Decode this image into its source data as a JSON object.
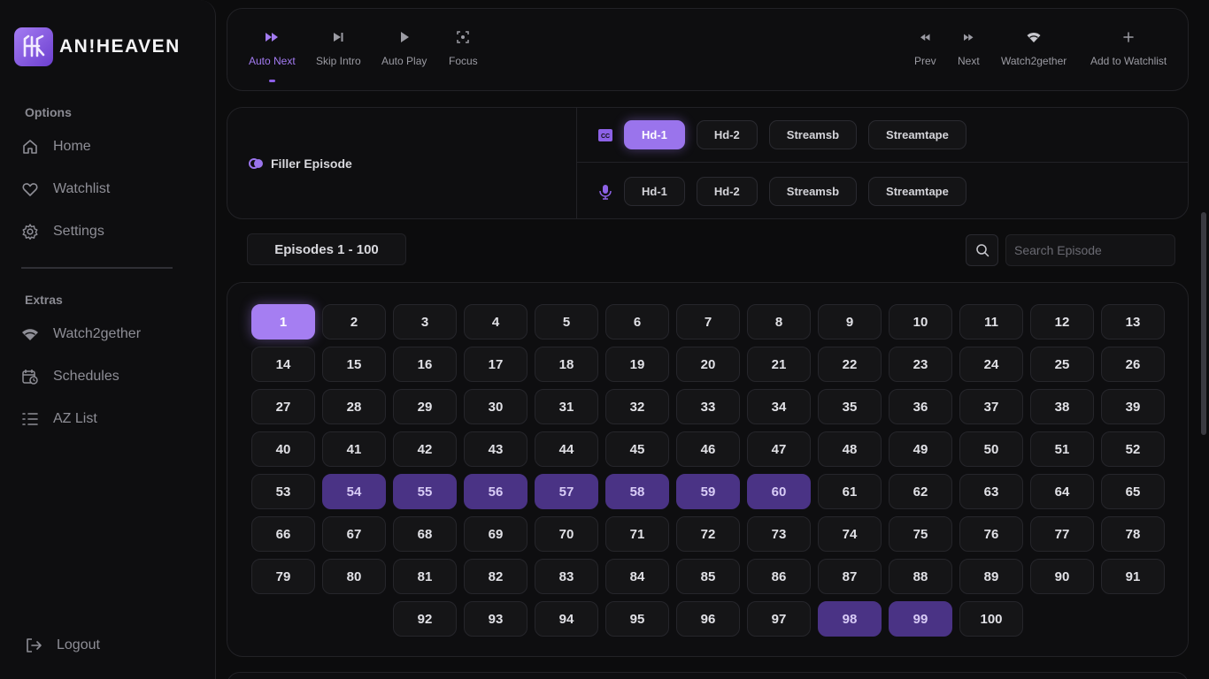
{
  "app": {
    "brand": "AN!HEAVEN",
    "accent_color": "#9a74ec",
    "filler_color": "#4a3385"
  },
  "sidebar": {
    "options_title": "Options",
    "options": [
      {
        "label": "Home",
        "icon": "home-icon"
      },
      {
        "label": "Watchlist",
        "icon": "heart-icon"
      },
      {
        "label": "Settings",
        "icon": "gear-icon"
      }
    ],
    "extras_title": "Extras",
    "extras": [
      {
        "label": "Watch2gether",
        "icon": "wifi-icon"
      },
      {
        "label": "Schedules",
        "icon": "calendar-clock-icon"
      },
      {
        "label": "AZ List",
        "icon": "list-icon"
      }
    ],
    "logout": "Logout"
  },
  "controls": {
    "left": [
      {
        "label": "Auto Next",
        "icon": "fast-forward-icon",
        "active": true
      },
      {
        "label": "Skip Intro",
        "icon": "skip-icon"
      },
      {
        "label": "Auto Play",
        "icon": "play-icon"
      },
      {
        "label": "Focus",
        "icon": "focus-icon"
      }
    ],
    "right": [
      {
        "label": "Prev",
        "icon": "rewind-icon"
      },
      {
        "label": "Next",
        "icon": "forward-icon"
      },
      {
        "label": "Watch2gether",
        "icon": "wifi-icon"
      },
      {
        "label": "Add to Watchlist",
        "icon": "plus-icon"
      }
    ]
  },
  "servers": {
    "filler_label": "Filler Episode",
    "sub": {
      "icon": "cc-icon",
      "selected": "Hd-1",
      "options": [
        "Hd-1",
        "Hd-2",
        "Streamsb",
        "Streamtape"
      ]
    },
    "dub": {
      "icon": "microphone-icon",
      "options": [
        "Hd-1",
        "Hd-2",
        "Streamsb",
        "Streamtape"
      ]
    }
  },
  "episodes": {
    "range_label": "Episodes 1 - 100",
    "search_placeholder": "Search Episode",
    "first": 1,
    "last": 100,
    "current": 1,
    "filler": [
      54,
      55,
      56,
      57,
      58,
      59,
      60,
      98,
      99
    ]
  }
}
